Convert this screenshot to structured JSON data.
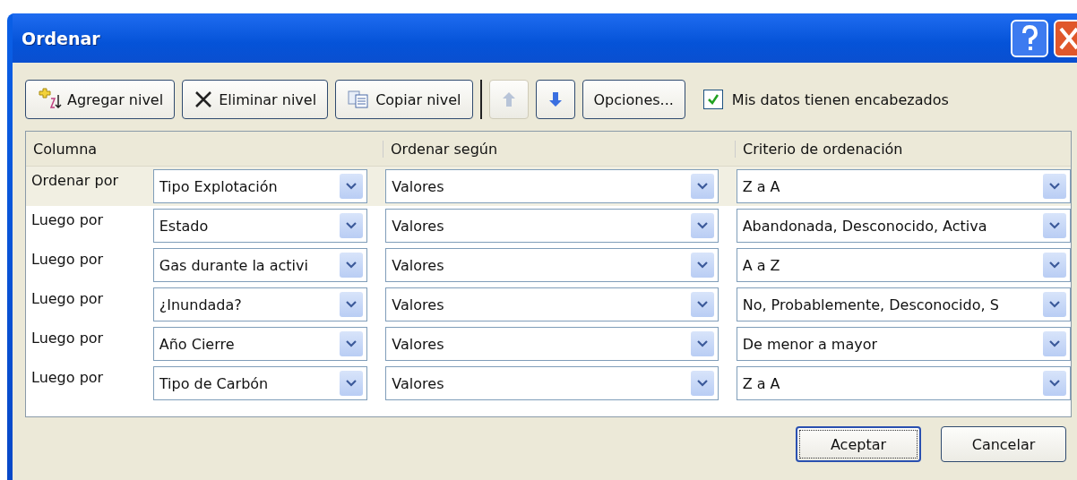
{
  "window": {
    "title": "Ordenar"
  },
  "toolbar": {
    "add": "Agregar nivel",
    "delete": "Eliminar nivel",
    "copy": "Copiar nivel",
    "move_up_disabled": true,
    "move_down_disabled": false,
    "options": "Opciones...",
    "headers": {
      "label": "Mis datos tienen encabezados",
      "checked": true
    }
  },
  "table": {
    "columns": [
      "Columna",
      "Ordenar según",
      "Criterio de ordenación"
    ],
    "rows": [
      {
        "label": "Ordenar por",
        "column": "Tipo Explotación",
        "sort_on": "Valores",
        "order": "Z a A",
        "selected": true
      },
      {
        "label": "Luego por",
        "column": "Estado",
        "sort_on": "Valores",
        "order": "Abandonada, Desconocido, Activa",
        "selected": false
      },
      {
        "label": "Luego por",
        "column": "Gas durante la activi",
        "sort_on": "Valores",
        "order": "A a Z",
        "selected": false
      },
      {
        "label": "Luego por",
        "column": "¿Inundada?",
        "sort_on": "Valores",
        "order": "No, Probablemente, Desconocido, S",
        "selected": false
      },
      {
        "label": "Luego por",
        "column": "Año Cierre",
        "sort_on": "Valores",
        "order": "De menor a mayor",
        "selected": false
      },
      {
        "label": "Luego por",
        "column": "Tipo de Carbón",
        "sort_on": "Valores",
        "order": "Z a A",
        "selected": false
      }
    ]
  },
  "buttons": {
    "ok": "Aceptar",
    "cancel": "Cancelar"
  }
}
